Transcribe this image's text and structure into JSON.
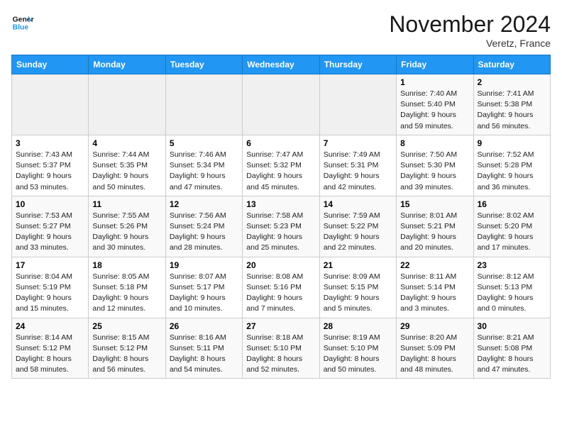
{
  "header": {
    "logo_line1": "General",
    "logo_line2": "Blue",
    "month": "November 2024",
    "location": "Veretz, France"
  },
  "days_of_week": [
    "Sunday",
    "Monday",
    "Tuesday",
    "Wednesday",
    "Thursday",
    "Friday",
    "Saturday"
  ],
  "weeks": [
    [
      {
        "day": "",
        "info": ""
      },
      {
        "day": "",
        "info": ""
      },
      {
        "day": "",
        "info": ""
      },
      {
        "day": "",
        "info": ""
      },
      {
        "day": "",
        "info": ""
      },
      {
        "day": "1",
        "info": "Sunrise: 7:40 AM\nSunset: 5:40 PM\nDaylight: 9 hours\nand 59 minutes."
      },
      {
        "day": "2",
        "info": "Sunrise: 7:41 AM\nSunset: 5:38 PM\nDaylight: 9 hours\nand 56 minutes."
      }
    ],
    [
      {
        "day": "3",
        "info": "Sunrise: 7:43 AM\nSunset: 5:37 PM\nDaylight: 9 hours\nand 53 minutes."
      },
      {
        "day": "4",
        "info": "Sunrise: 7:44 AM\nSunset: 5:35 PM\nDaylight: 9 hours\nand 50 minutes."
      },
      {
        "day": "5",
        "info": "Sunrise: 7:46 AM\nSunset: 5:34 PM\nDaylight: 9 hours\nand 47 minutes."
      },
      {
        "day": "6",
        "info": "Sunrise: 7:47 AM\nSunset: 5:32 PM\nDaylight: 9 hours\nand 45 minutes."
      },
      {
        "day": "7",
        "info": "Sunrise: 7:49 AM\nSunset: 5:31 PM\nDaylight: 9 hours\nand 42 minutes."
      },
      {
        "day": "8",
        "info": "Sunrise: 7:50 AM\nSunset: 5:30 PM\nDaylight: 9 hours\nand 39 minutes."
      },
      {
        "day": "9",
        "info": "Sunrise: 7:52 AM\nSunset: 5:28 PM\nDaylight: 9 hours\nand 36 minutes."
      }
    ],
    [
      {
        "day": "10",
        "info": "Sunrise: 7:53 AM\nSunset: 5:27 PM\nDaylight: 9 hours\nand 33 minutes."
      },
      {
        "day": "11",
        "info": "Sunrise: 7:55 AM\nSunset: 5:26 PM\nDaylight: 9 hours\nand 30 minutes."
      },
      {
        "day": "12",
        "info": "Sunrise: 7:56 AM\nSunset: 5:24 PM\nDaylight: 9 hours\nand 28 minutes."
      },
      {
        "day": "13",
        "info": "Sunrise: 7:58 AM\nSunset: 5:23 PM\nDaylight: 9 hours\nand 25 minutes."
      },
      {
        "day": "14",
        "info": "Sunrise: 7:59 AM\nSunset: 5:22 PM\nDaylight: 9 hours\nand 22 minutes."
      },
      {
        "day": "15",
        "info": "Sunrise: 8:01 AM\nSunset: 5:21 PM\nDaylight: 9 hours\nand 20 minutes."
      },
      {
        "day": "16",
        "info": "Sunrise: 8:02 AM\nSunset: 5:20 PM\nDaylight: 9 hours\nand 17 minutes."
      }
    ],
    [
      {
        "day": "17",
        "info": "Sunrise: 8:04 AM\nSunset: 5:19 PM\nDaylight: 9 hours\nand 15 minutes."
      },
      {
        "day": "18",
        "info": "Sunrise: 8:05 AM\nSunset: 5:18 PM\nDaylight: 9 hours\nand 12 minutes."
      },
      {
        "day": "19",
        "info": "Sunrise: 8:07 AM\nSunset: 5:17 PM\nDaylight: 9 hours\nand 10 minutes."
      },
      {
        "day": "20",
        "info": "Sunrise: 8:08 AM\nSunset: 5:16 PM\nDaylight: 9 hours\nand 7 minutes."
      },
      {
        "day": "21",
        "info": "Sunrise: 8:09 AM\nSunset: 5:15 PM\nDaylight: 9 hours\nand 5 minutes."
      },
      {
        "day": "22",
        "info": "Sunrise: 8:11 AM\nSunset: 5:14 PM\nDaylight: 9 hours\nand 3 minutes."
      },
      {
        "day": "23",
        "info": "Sunrise: 8:12 AM\nSunset: 5:13 PM\nDaylight: 9 hours\nand 0 minutes."
      }
    ],
    [
      {
        "day": "24",
        "info": "Sunrise: 8:14 AM\nSunset: 5:12 PM\nDaylight: 8 hours\nand 58 minutes."
      },
      {
        "day": "25",
        "info": "Sunrise: 8:15 AM\nSunset: 5:12 PM\nDaylight: 8 hours\nand 56 minutes."
      },
      {
        "day": "26",
        "info": "Sunrise: 8:16 AM\nSunset: 5:11 PM\nDaylight: 8 hours\nand 54 minutes."
      },
      {
        "day": "27",
        "info": "Sunrise: 8:18 AM\nSunset: 5:10 PM\nDaylight: 8 hours\nand 52 minutes."
      },
      {
        "day": "28",
        "info": "Sunrise: 8:19 AM\nSunset: 5:10 PM\nDaylight: 8 hours\nand 50 minutes."
      },
      {
        "day": "29",
        "info": "Sunrise: 8:20 AM\nSunset: 5:09 PM\nDaylight: 8 hours\nand 48 minutes."
      },
      {
        "day": "30",
        "info": "Sunrise: 8:21 AM\nSunset: 5:08 PM\nDaylight: 8 hours\nand 47 minutes."
      }
    ]
  ]
}
